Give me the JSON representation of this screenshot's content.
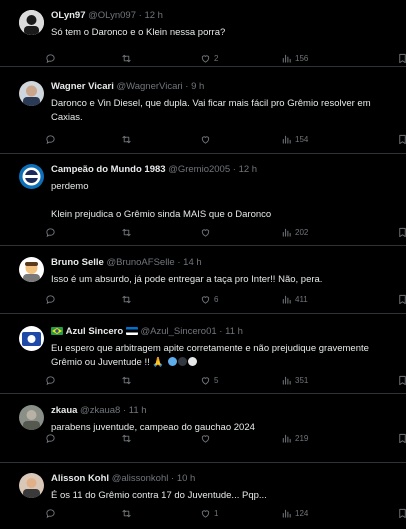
{
  "tweets": [
    {
      "name": "OLyn97",
      "handle": "@OLyn097",
      "time": "12 h",
      "text": [
        "Só tem o Daronco e o Klein nessa porra?"
      ],
      "replies": "",
      "retweets": "",
      "likes": "2",
      "views": "156"
    },
    {
      "name": "Wagner Vicari",
      "handle": "@WagnerVicari",
      "time": "9 h",
      "text": [
        "Daronco e Vin Diesel, que dupla. Vai ficar mais fácil pro Grêmio resolver em",
        "Caxias."
      ],
      "replies": "",
      "retweets": "",
      "likes": "",
      "views": "154"
    },
    {
      "name": "Campeão do Mundo 1983",
      "handle": "@Gremio2005",
      "time": "12 h",
      "text": [
        "perdemo",
        "",
        "Klein prejudica o Grêmio sinda MAIS que o Daronco"
      ],
      "replies": "",
      "retweets": "",
      "likes": "",
      "views": "202"
    },
    {
      "name": "Bruno Selle",
      "handle": "@BrunoAFSelle",
      "time": "14 h",
      "text": [
        "Isso é um absurdo, já pode entregar a taça pro Inter!! Não, pera."
      ],
      "replies": "",
      "retweets": "",
      "likes": "6",
      "views": "411"
    },
    {
      "name": "Azul Sincero",
      "handle": "@Azul_Sincero01",
      "time": "11 h",
      "text": [
        "Eu espero que arbitragem apite corretamente e não prejudique gravemente",
        "Grêmio ou Juventude !! 🙏"
      ],
      "replies": "",
      "retweets": "",
      "likes": "5",
      "views": "351"
    },
    {
      "name": "zkaua",
      "handle": "@zkaua8",
      "time": "11 h",
      "text": [
        "parabens juventude, campeao do gauchao 2024"
      ],
      "replies": "",
      "retweets": "",
      "likes": "",
      "views": "219"
    },
    {
      "name": "Alisson Kohl",
      "handle": "@alissonkohl",
      "time": "10 h",
      "text": [
        "É os 11 do Grêmio contra 17 do Juventude... Pqp..."
      ],
      "replies": "",
      "retweets": "",
      "likes": "1",
      "views": "124"
    }
  ],
  "icons": [
    "reply-icon",
    "retweet-icon",
    "like-icon",
    "views-icon",
    "bookmark-icon",
    "share-icon"
  ],
  "colors": {
    "background": "#000000",
    "text": "#e7e9ea",
    "muted": "#71767b",
    "divider": "#2f3336"
  }
}
